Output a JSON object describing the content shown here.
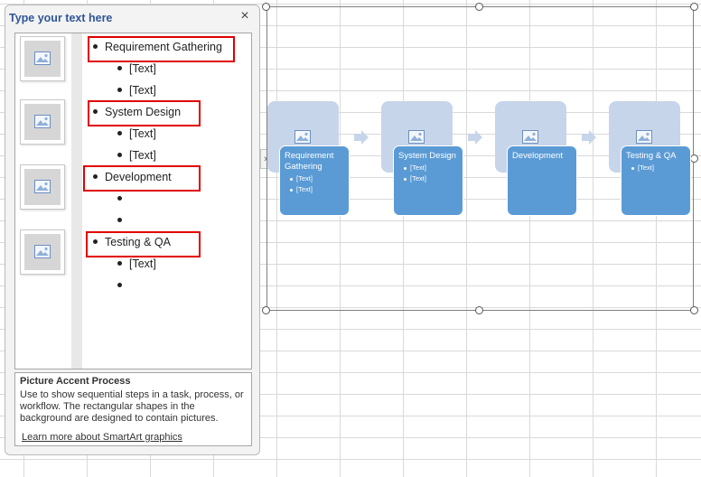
{
  "text_pane": {
    "title": "Type your text here",
    "close_glyph": "×",
    "items": [
      {
        "text": "Requirement Gathering",
        "children": [
          "[Text]",
          "[Text]"
        ]
      },
      {
        "text": "System Design",
        "children": [
          "[Text]",
          "[Text]"
        ]
      },
      {
        "text": "Development",
        "children": [
          "",
          ""
        ]
      },
      {
        "text": "Testing & QA",
        "children": [
          "[Text]",
          ""
        ]
      }
    ],
    "description": {
      "title": "Picture Accent Process",
      "body": "Use to show sequential steps in a task, process, or workflow. The rectangular shapes in the background are designed to contain pictures.",
      "link": "Learn more about SmartArt graphics"
    }
  },
  "smartart": {
    "expand_glyph": "›",
    "steps": [
      {
        "title": "Requirement Gathering",
        "subs": [
          "[Text]",
          "[Text]"
        ]
      },
      {
        "title": "System Design",
        "subs": [
          "[Text]",
          "[Text]"
        ]
      },
      {
        "title": "Development",
        "subs": []
      },
      {
        "title": "Testing & QA",
        "subs": [
          "[Text]"
        ]
      }
    ]
  },
  "colors": {
    "step_fill": "#5b9bd5",
    "picture_bg": "#c7d5ea",
    "highlight": "#e00000",
    "pane_title": "#2f5597"
  },
  "icons": [
    "picture-icon",
    "close-icon",
    "arrow-right-icon",
    "chevron-right-icon"
  ]
}
